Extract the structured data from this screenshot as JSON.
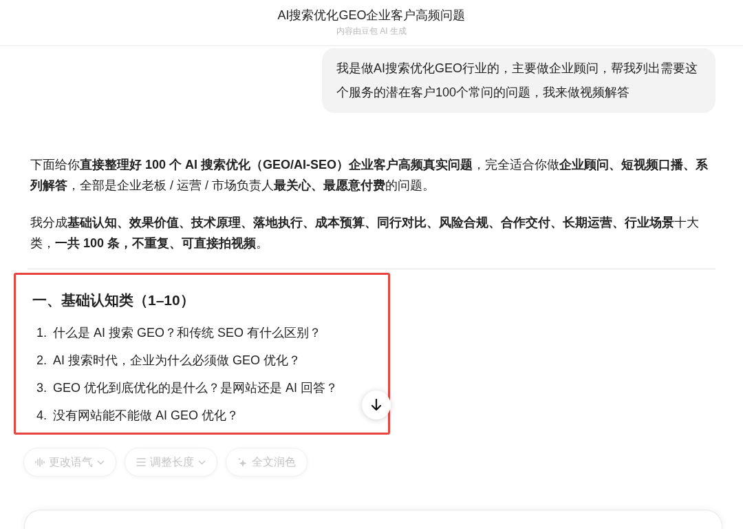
{
  "header": {
    "title": "AI搜索优化GEO企业客户高频问题",
    "subtitle": "内容由豆包 AI 生成"
  },
  "user_message": "我是做AI搜索优化GEO行业的，主要做企业顾问，帮我列出需要这个服务的潜在客户100个常问的问题，我来做视频解答",
  "answer": {
    "paragraphs": [
      "下面给你**直接整理好 100 个 AI 搜索优化（GEO/AI-SEO）企业客户高频真实问题**，完全适合你做**企业顾问、短视频口播、系列解答**，全部是企业老板 / 运营 / 市场负责人**最关心、最愿意付费**的问题。",
      "我分成**基础认知、效果价值、技术原理、落地执行、成本预算、同行对比、风险合规、合作交付、长期运营、行业场景**十大类，**一共 100 条，不重复、可直接拍视频**。"
    ],
    "section": {
      "heading": "一、基础认知类（1–10）",
      "highlighted": true,
      "items": [
        {
          "number": "1.",
          "text": "什么是 AI 搜索 GEO？和传统 SEO 有什么区别？"
        },
        {
          "number": "2.",
          "text": "AI 搜索时代，企业为什么必须做 GEO 优化？"
        },
        {
          "number": "3.",
          "text": "GEO 优化到底优化的是什么？是网站还是 AI 回答？"
        },
        {
          "number": "4.",
          "text": "没有网站能不能做 AI GEO 优化？"
        }
      ]
    }
  },
  "toolbar": [
    {
      "kind": "tone",
      "label": "更改语气",
      "dropdown": true
    },
    {
      "kind": "length",
      "label": "调整长度",
      "dropdown": true
    },
    {
      "kind": "polish",
      "label": "全文润色",
      "dropdown": false
    }
  ]
}
